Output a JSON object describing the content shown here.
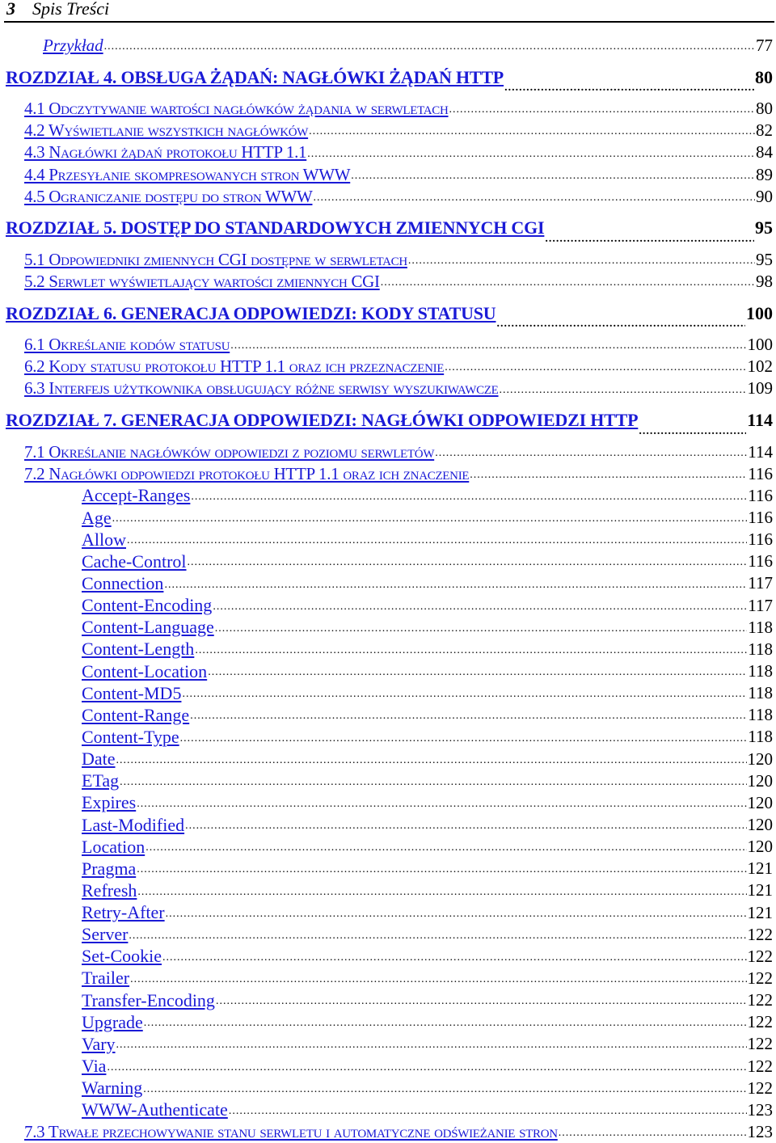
{
  "header": {
    "page_number": "3",
    "title": "Spis Treści"
  },
  "link_color": "#1a1ad6",
  "toc": [
    {
      "level": 2,
      "text": "Przykład",
      "page": "77"
    },
    {
      "level": 0,
      "text": "ROZDZIAŁ 4. OBSŁUGA ŻĄDAŃ: NAGŁÓWKI ŻĄDAŃ HTTP",
      "page": "80"
    },
    {
      "level": 1,
      "text": "4.1 Odczytywanie wartości nagłówków żądania w serwletach",
      "page": "80"
    },
    {
      "level": 1,
      "text": "4.2 Wyświetlanie wszystkich nagłówków",
      "page": "82"
    },
    {
      "level": 1,
      "text": "4.3 Nagłówki żądań protokołu HTTP 1.1",
      "page": "84"
    },
    {
      "level": 1,
      "text": "4.4 Przesyłanie skompresowanych stron WWW",
      "page": "89"
    },
    {
      "level": 1,
      "text": "4.5 Ograniczanie dostępu do stron WWW",
      "page": "90"
    },
    {
      "level": 0,
      "text": "ROZDZIAŁ 5. DOSTĘP DO STANDARDOWYCH ZMIENNYCH CGI",
      "page": "95"
    },
    {
      "level": 1,
      "text": "5.1 Odpowiedniki zmiennych CGI dostępne w serwletach",
      "page": "95"
    },
    {
      "level": 1,
      "text": "5.2 Serwlet wyświetlający wartości zmiennych CGI",
      "page": "98"
    },
    {
      "level": 0,
      "text": "ROZDZIAŁ 6. GENERACJA ODPOWIEDZI: KODY STATUSU",
      "page": "100"
    },
    {
      "level": 1,
      "text": "6.1 Określanie kodów statusu",
      "page": "100"
    },
    {
      "level": 1,
      "text": "6.2 Kody statusu protokołu HTTP 1.1 oraz ich przeznaczenie",
      "page": "102"
    },
    {
      "level": 1,
      "text": "6.3 Interfejs użytkownika obsługujący różne serwisy wyszukiwawcze",
      "page": "109"
    },
    {
      "level": 0,
      "text": "ROZDZIAŁ 7. GENERACJA ODPOWIEDZI: NAGŁÓWKI ODPOWIEDZI HTTP",
      "page": "114"
    },
    {
      "level": 1,
      "text": "7.1 Określanie nagłówków odpowiedzi z poziomu serwletów",
      "page": "114"
    },
    {
      "level": 1,
      "text": "7.2 Nagłówki odpowiedzi protokołu HTTP 1.1 oraz ich znaczenie",
      "page": "116"
    },
    {
      "level": 3,
      "text": "Accept-Ranges",
      "page": "116"
    },
    {
      "level": 3,
      "text": "Age",
      "page": "116"
    },
    {
      "level": 3,
      "text": "Allow",
      "page": "116"
    },
    {
      "level": 3,
      "text": "Cache-Control",
      "page": "116"
    },
    {
      "level": 3,
      "text": "Connection",
      "page": "117"
    },
    {
      "level": 3,
      "text": "Content-Encoding",
      "page": "117"
    },
    {
      "level": 3,
      "text": "Content-Language",
      "page": "118"
    },
    {
      "level": 3,
      "text": "Content-Length",
      "page": "118"
    },
    {
      "level": 3,
      "text": "Content-Location",
      "page": "118"
    },
    {
      "level": 3,
      "text": "Content-MD5",
      "page": "118"
    },
    {
      "level": 3,
      "text": "Content-Range",
      "page": "118"
    },
    {
      "level": 3,
      "text": "Content-Type",
      "page": "118"
    },
    {
      "level": 3,
      "text": "Date",
      "page": "120"
    },
    {
      "level": 3,
      "text": "ETag",
      "page": "120"
    },
    {
      "level": 3,
      "text": "Expires",
      "page": "120"
    },
    {
      "level": 3,
      "text": "Last-Modified",
      "page": "120"
    },
    {
      "level": 3,
      "text": "Location",
      "page": "120"
    },
    {
      "level": 3,
      "text": "Pragma",
      "page": "121"
    },
    {
      "level": 3,
      "text": "Refresh",
      "page": "121"
    },
    {
      "level": 3,
      "text": "Retry-After",
      "page": "121"
    },
    {
      "level": 3,
      "text": "Server",
      "page": "122"
    },
    {
      "level": 3,
      "text": "Set-Cookie",
      "page": "122"
    },
    {
      "level": 3,
      "text": "Trailer",
      "page": "122"
    },
    {
      "level": 3,
      "text": "Transfer-Encoding",
      "page": "122"
    },
    {
      "level": 3,
      "text": "Upgrade",
      "page": "122"
    },
    {
      "level": 3,
      "text": "Vary",
      "page": "122"
    },
    {
      "level": 3,
      "text": "Via",
      "page": "122"
    },
    {
      "level": 3,
      "text": "Warning",
      "page": "122"
    },
    {
      "level": 3,
      "text": "WWW-Authenticate",
      "page": "123"
    },
    {
      "level": 1,
      "text": "7.3 Trwałe przechowywanie stanu serwletu i automatyczne odświeżanie stron",
      "page": "123"
    }
  ]
}
